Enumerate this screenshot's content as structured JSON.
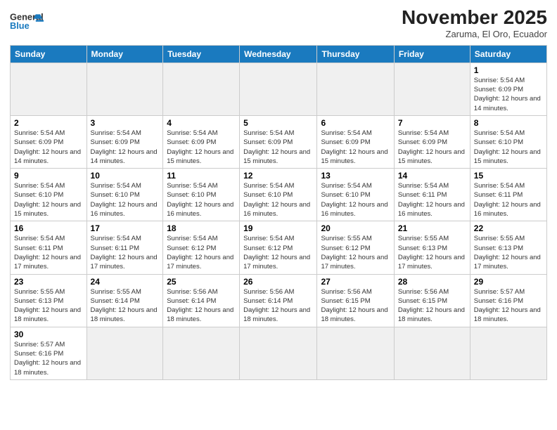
{
  "header": {
    "logo_general": "General",
    "logo_blue": "Blue",
    "month_title": "November 2025",
    "subtitle": "Zaruma, El Oro, Ecuador"
  },
  "days_of_week": [
    "Sunday",
    "Monday",
    "Tuesday",
    "Wednesday",
    "Thursday",
    "Friday",
    "Saturday"
  ],
  "weeks": [
    [
      {
        "day": "",
        "info": ""
      },
      {
        "day": "",
        "info": ""
      },
      {
        "day": "",
        "info": ""
      },
      {
        "day": "",
        "info": ""
      },
      {
        "day": "",
        "info": ""
      },
      {
        "day": "",
        "info": ""
      },
      {
        "day": "1",
        "info": "Sunrise: 5:54 AM\nSunset: 6:09 PM\nDaylight: 12 hours\nand 14 minutes."
      }
    ],
    [
      {
        "day": "2",
        "info": "Sunrise: 5:54 AM\nSunset: 6:09 PM\nDaylight: 12 hours\nand 14 minutes."
      },
      {
        "day": "3",
        "info": "Sunrise: 5:54 AM\nSunset: 6:09 PM\nDaylight: 12 hours\nand 14 minutes."
      },
      {
        "day": "4",
        "info": "Sunrise: 5:54 AM\nSunset: 6:09 PM\nDaylight: 12 hours\nand 15 minutes."
      },
      {
        "day": "5",
        "info": "Sunrise: 5:54 AM\nSunset: 6:09 PM\nDaylight: 12 hours\nand 15 minutes."
      },
      {
        "day": "6",
        "info": "Sunrise: 5:54 AM\nSunset: 6:09 PM\nDaylight: 12 hours\nand 15 minutes."
      },
      {
        "day": "7",
        "info": "Sunrise: 5:54 AM\nSunset: 6:09 PM\nDaylight: 12 hours\nand 15 minutes."
      },
      {
        "day": "8",
        "info": "Sunrise: 5:54 AM\nSunset: 6:10 PM\nDaylight: 12 hours\nand 15 minutes."
      }
    ],
    [
      {
        "day": "9",
        "info": "Sunrise: 5:54 AM\nSunset: 6:10 PM\nDaylight: 12 hours\nand 15 minutes."
      },
      {
        "day": "10",
        "info": "Sunrise: 5:54 AM\nSunset: 6:10 PM\nDaylight: 12 hours\nand 16 minutes."
      },
      {
        "day": "11",
        "info": "Sunrise: 5:54 AM\nSunset: 6:10 PM\nDaylight: 12 hours\nand 16 minutes."
      },
      {
        "day": "12",
        "info": "Sunrise: 5:54 AM\nSunset: 6:10 PM\nDaylight: 12 hours\nand 16 minutes."
      },
      {
        "day": "13",
        "info": "Sunrise: 5:54 AM\nSunset: 6:10 PM\nDaylight: 12 hours\nand 16 minutes."
      },
      {
        "day": "14",
        "info": "Sunrise: 5:54 AM\nSunset: 6:11 PM\nDaylight: 12 hours\nand 16 minutes."
      },
      {
        "day": "15",
        "info": "Sunrise: 5:54 AM\nSunset: 6:11 PM\nDaylight: 12 hours\nand 16 minutes."
      }
    ],
    [
      {
        "day": "16",
        "info": "Sunrise: 5:54 AM\nSunset: 6:11 PM\nDaylight: 12 hours\nand 17 minutes."
      },
      {
        "day": "17",
        "info": "Sunrise: 5:54 AM\nSunset: 6:11 PM\nDaylight: 12 hours\nand 17 minutes."
      },
      {
        "day": "18",
        "info": "Sunrise: 5:54 AM\nSunset: 6:12 PM\nDaylight: 12 hours\nand 17 minutes."
      },
      {
        "day": "19",
        "info": "Sunrise: 5:54 AM\nSunset: 6:12 PM\nDaylight: 12 hours\nand 17 minutes."
      },
      {
        "day": "20",
        "info": "Sunrise: 5:55 AM\nSunset: 6:12 PM\nDaylight: 12 hours\nand 17 minutes."
      },
      {
        "day": "21",
        "info": "Sunrise: 5:55 AM\nSunset: 6:13 PM\nDaylight: 12 hours\nand 17 minutes."
      },
      {
        "day": "22",
        "info": "Sunrise: 5:55 AM\nSunset: 6:13 PM\nDaylight: 12 hours\nand 17 minutes."
      }
    ],
    [
      {
        "day": "23",
        "info": "Sunrise: 5:55 AM\nSunset: 6:13 PM\nDaylight: 12 hours\nand 18 minutes."
      },
      {
        "day": "24",
        "info": "Sunrise: 5:55 AM\nSunset: 6:14 PM\nDaylight: 12 hours\nand 18 minutes."
      },
      {
        "day": "25",
        "info": "Sunrise: 5:56 AM\nSunset: 6:14 PM\nDaylight: 12 hours\nand 18 minutes."
      },
      {
        "day": "26",
        "info": "Sunrise: 5:56 AM\nSunset: 6:14 PM\nDaylight: 12 hours\nand 18 minutes."
      },
      {
        "day": "27",
        "info": "Sunrise: 5:56 AM\nSunset: 6:15 PM\nDaylight: 12 hours\nand 18 minutes."
      },
      {
        "day": "28",
        "info": "Sunrise: 5:56 AM\nSunset: 6:15 PM\nDaylight: 12 hours\nand 18 minutes."
      },
      {
        "day": "29",
        "info": "Sunrise: 5:57 AM\nSunset: 6:16 PM\nDaylight: 12 hours\nand 18 minutes."
      }
    ],
    [
      {
        "day": "30",
        "info": "Sunrise: 5:57 AM\nSunset: 6:16 PM\nDaylight: 12 hours\nand 18 minutes."
      },
      {
        "day": "",
        "info": ""
      },
      {
        "day": "",
        "info": ""
      },
      {
        "day": "",
        "info": ""
      },
      {
        "day": "",
        "info": ""
      },
      {
        "day": "",
        "info": ""
      },
      {
        "day": "",
        "info": ""
      }
    ]
  ]
}
